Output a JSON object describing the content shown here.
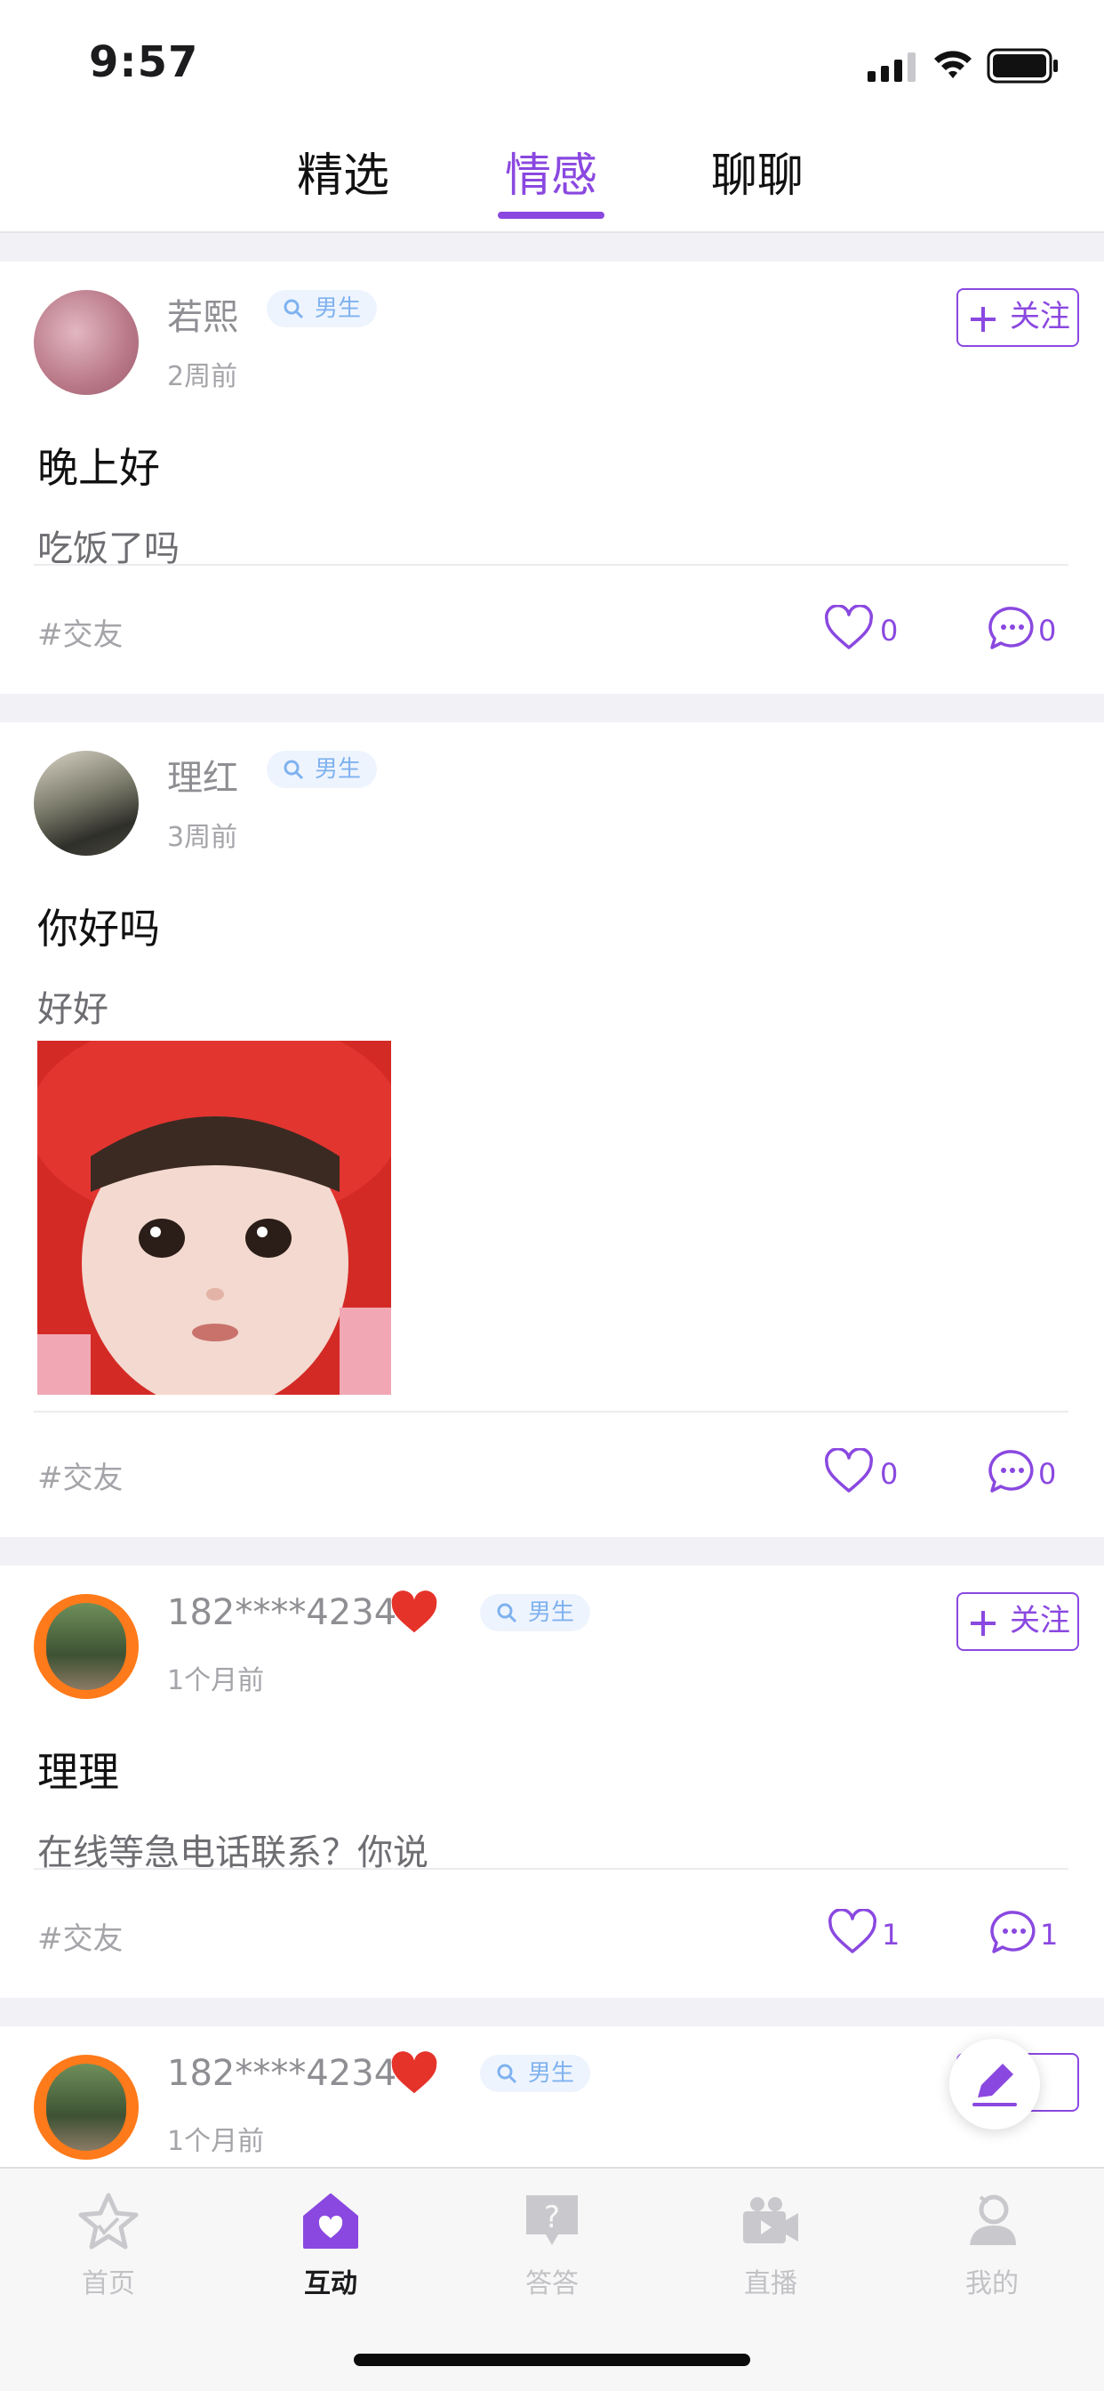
{
  "status_bar": {
    "time": "9:57"
  },
  "top_tabs": [
    {
      "label": "精选",
      "active": false
    },
    {
      "label": "情感",
      "active": true
    },
    {
      "label": "聊聊",
      "active": false
    }
  ],
  "accent_color": "#8a48e0",
  "posts": [
    {
      "username": "若熙",
      "gender_tag": "男生",
      "time": "2周前",
      "title": "晚上好",
      "body": "吃饭了吗",
      "topic": "#交友",
      "likes": "0",
      "comments": "0",
      "follow_label": "关注",
      "has_follow": true,
      "has_image": false
    },
    {
      "username": "理红",
      "gender_tag": "男生",
      "time": "3周前",
      "title": "你好吗",
      "body": "好好",
      "topic": "#交友",
      "likes": "0",
      "comments": "0",
      "has_follow": false,
      "has_image": true
    },
    {
      "username": "182****4234",
      "gender_tag": "男生",
      "time": "1个月前",
      "title": "理理",
      "body": "在线等急电话联系？你说",
      "topic": "#交友",
      "likes": "1",
      "comments": "1",
      "follow_label": "关注",
      "has_follow": true,
      "has_image": false
    },
    {
      "username": "182****4234",
      "gender_tag": "男生",
      "time": "1个月前",
      "follow_label": "注",
      "has_follow": true
    }
  ],
  "bottom_tabs": [
    {
      "label": "首页",
      "icon": "star-home-icon",
      "active": false
    },
    {
      "label": "互动",
      "icon": "heart-house-icon",
      "active": true
    },
    {
      "label": "答答",
      "icon": "question-bubble-icon",
      "active": false
    },
    {
      "label": "直播",
      "icon": "video-camera-icon",
      "active": false
    },
    {
      "label": "我的",
      "icon": "person-icon",
      "active": false
    }
  ]
}
